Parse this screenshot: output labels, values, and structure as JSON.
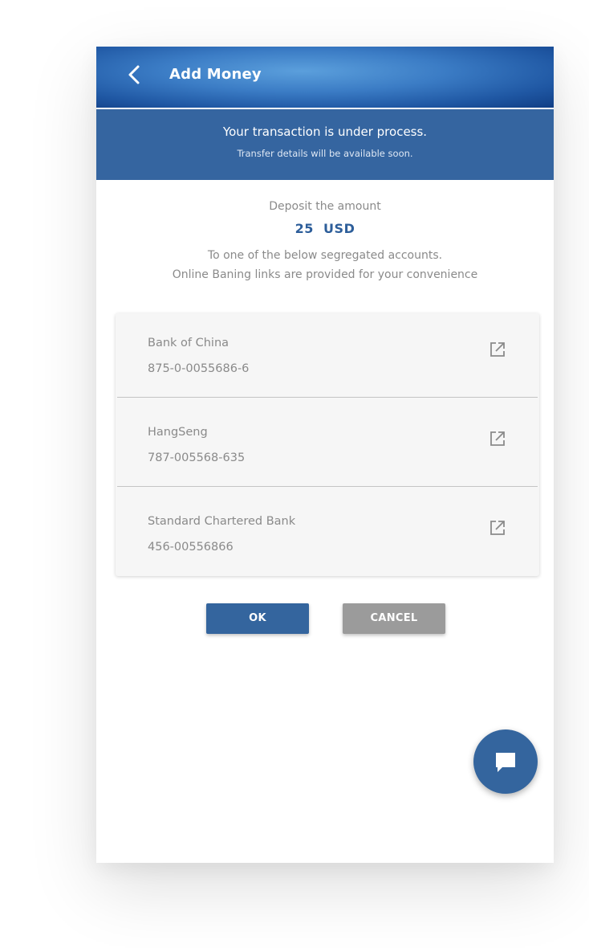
{
  "appbar": {
    "title": "Add Money",
    "back_icon": "chevron-left-icon"
  },
  "status": {
    "title": "Your transaction is under process.",
    "subtitle": "Transfer details will be available soon."
  },
  "deposit": {
    "label": "Deposit the amount",
    "amount": "25  USD",
    "instruction_line1": "To one of the below segregated accounts.",
    "instruction_line2": "Online Baning links are provided for your convenience"
  },
  "accounts": [
    {
      "bank": "Bank of China",
      "number": "875-0-0055686-6",
      "icon": "external-link-icon"
    },
    {
      "bank": "HangSeng",
      "number": "787-005568-635",
      "icon": "external-link-icon"
    },
    {
      "bank": "Standard Chartered Bank",
      "number": "456-00556866",
      "icon": "external-link-icon"
    }
  ],
  "actions": {
    "ok_label": "OK",
    "cancel_label": "CANCEL"
  },
  "fab": {
    "icon": "chat-icon"
  },
  "colors": {
    "primary": "#34659e",
    "banner": "#3565a0",
    "amount": "#2d5e9a",
    "text_muted": "#8a8a8a",
    "cancel": "#9b9b9b",
    "card_bg": "#f6f6f6"
  }
}
